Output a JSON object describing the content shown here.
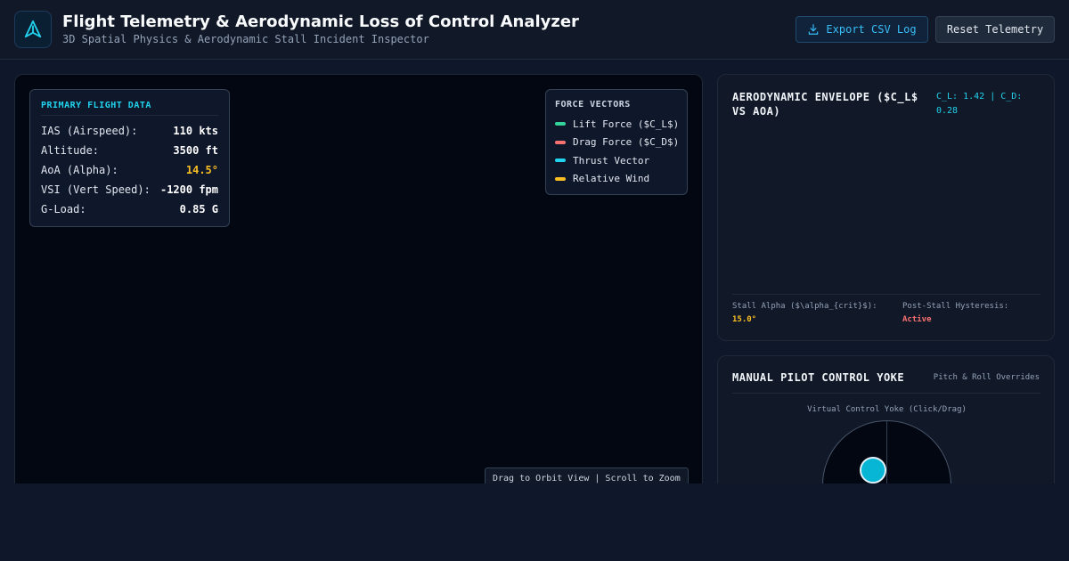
{
  "header": {
    "title": "Flight Telemetry & Aerodynamic Loss of Control Analyzer",
    "subtitle": "3D Spatial Physics & Aerodynamic Stall Incident Inspector",
    "export_label": "Export CSV Log",
    "reset_label": "Reset Telemetry",
    "logo_icon": "aircraft-logo-icon",
    "export_icon": "download-icon"
  },
  "pfd": {
    "title": "PRIMARY FLIGHT DATA",
    "rows": [
      {
        "label": "IAS (Airspeed):",
        "value": "110 kts"
      },
      {
        "label": "Altitude:",
        "value": "3500 ft"
      },
      {
        "label": "AoA (Alpha):",
        "value": "14.5°"
      },
      {
        "label": "VSI (Vert Speed):",
        "value": "-1200 fpm"
      },
      {
        "label": "G-Load:",
        "value": "0.85 G"
      }
    ]
  },
  "legend": {
    "title": "FORCE VECTORS",
    "items": [
      {
        "label": "Lift Force ($C_L$)",
        "color": "#34d399"
      },
      {
        "label": "Drag Force ($C_D$)",
        "color": "#f87171"
      },
      {
        "label": "Thrust Vector",
        "color": "#22d3ee"
      },
      {
        "label": "Relative Wind",
        "color": "#fbbf24"
      }
    ]
  },
  "viewport": {
    "hint": "Drag to Orbit View | Scroll to Zoom"
  },
  "aero": {
    "title": "AERODYNAMIC ENVELOPE ($C_L$ VS AOA)",
    "readout": "C_L: 1.42 | C_D: 0.28",
    "stall_label": "Stall Alpha ($\\alpha_{crit}$):",
    "stall_value": "15.0°",
    "hysteresis_label": "Post-Stall Hysteresis:",
    "hysteresis_value": "Active"
  },
  "yoke": {
    "title": "MANUAL PILOT CONTROL YOKE",
    "subtitle": "Pitch & Roll Overrides",
    "pad_label": "Virtual Control Yoke (Click/Drag)"
  },
  "colors": {
    "accent": "#22d3ee",
    "warning": "#fbbf24",
    "danger": "#f87171",
    "background": "#0f172a"
  }
}
